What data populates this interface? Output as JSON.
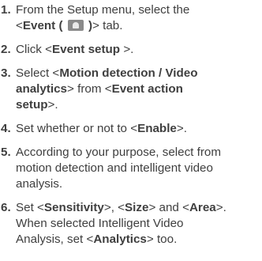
{
  "steps": [
    {
      "num": "1.",
      "l1": "From the Setup menu, select the",
      "l2_pre": "<",
      "l2_b": "Event (",
      "icon": "event-siren-icon",
      "l2_b2": ")",
      "l2_post": "> tab."
    },
    {
      "num": "2.",
      "pre": "Click <",
      "b": "Event setup",
      "post": " >."
    },
    {
      "num": "3.",
      "l1_pre": "Select <",
      "l1_b": "Motion detection / Video",
      "l2_b": "analytics",
      "l2_mid": "> from <",
      "l2_b2": "Event action",
      "l3_b": "setup",
      "l3_post": ">."
    },
    {
      "num": "4.",
      "pre": "Set whether or not to <",
      "b": "Enable",
      "post": ">."
    },
    {
      "num": "5.",
      "l1": "According to your purpose, select from",
      "l2": "motion detection and intelligent video",
      "l3": "analysis."
    },
    {
      "num": "6.",
      "l1_pre": "Set <",
      "l1_b1": "Sensitivity",
      "l1_mid1": ">, <",
      "l1_b2": "Size",
      "l1_mid2": "> and <",
      "l1_b3": "Area",
      "l1_post": ">.",
      "l2": "When selected Intelligent Video",
      "l3_pre": "Analysis, set <",
      "l3_b": "Analytics",
      "l3_post": "> too."
    }
  ]
}
